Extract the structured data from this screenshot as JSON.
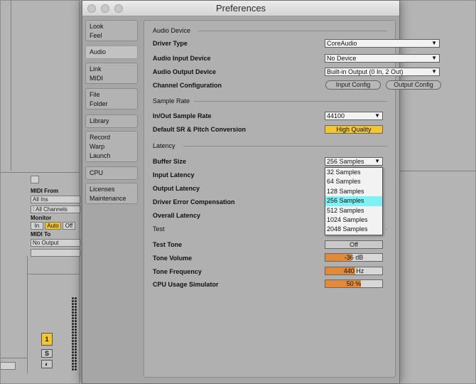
{
  "window": {
    "title": "Preferences"
  },
  "tabs": [
    {
      "lines": [
        "Look",
        "Feel"
      ],
      "active": false
    },
    {
      "lines": [
        "Audio"
      ],
      "active": true
    },
    {
      "lines": [
        "Link",
        "MIDI"
      ],
      "active": false
    },
    {
      "lines": [
        "File",
        "Folder"
      ],
      "active": false
    },
    {
      "lines": [
        "Library"
      ],
      "active": false
    },
    {
      "lines": [
        "Record",
        "Warp",
        "Launch"
      ],
      "active": false
    },
    {
      "lines": [
        "CPU"
      ],
      "active": false
    },
    {
      "lines": [
        "Licenses",
        "Maintenance"
      ],
      "active": false
    }
  ],
  "audio_device": {
    "heading": "Audio Device",
    "driver_type": {
      "label": "Driver Type",
      "value": "CoreAudio"
    },
    "input_device": {
      "label": "Audio Input Device",
      "value": "No Device"
    },
    "output_device": {
      "label": "Audio Output Device",
      "value": "Built-in Output (0 In, 2 Out)"
    },
    "channel_config": {
      "label": "Channel Configuration",
      "input_button": "Input Config",
      "output_button": "Output Config"
    }
  },
  "sample_rate": {
    "heading": "Sample Rate",
    "inout": {
      "label": "In/Out Sample Rate",
      "value": "44100"
    },
    "default_sr": {
      "label": "Default SR & Pitch Conversion",
      "value": "High Quality"
    }
  },
  "latency": {
    "heading": "Latency",
    "buffer_size": {
      "label": "Buffer Size",
      "value": "256 Samples"
    },
    "input_latency": {
      "label": "Input Latency"
    },
    "output_latency": {
      "label": "Output Latency"
    },
    "driver_error": {
      "label": "Driver Error Compensation"
    },
    "overall": {
      "label": "Overall Latency"
    },
    "buffer_options": [
      "32 Samples",
      "64 Samples",
      "128 Samples",
      "256 Samples",
      "512 Samples",
      "1024 Samples",
      "2048 Samples"
    ],
    "selected_index": 3
  },
  "test": {
    "heading": "Test",
    "test_tone": {
      "label": "Test Tone",
      "value": "Off"
    },
    "tone_volume": {
      "label": "Tone Volume",
      "value": "-36 dB",
      "fill": 0.46
    },
    "tone_frequency": {
      "label": "Tone Frequency",
      "value": "440 Hz",
      "fill": 0.52
    },
    "cpu_sim": {
      "label": "CPU Usage Simulator",
      "value": "50 %",
      "fill": 0.62
    }
  },
  "mixer": {
    "midi_from_label": "MIDI From",
    "midi_from_value": "All Ins",
    "channel_value": "All Channels",
    "monitor_label": "Monitor",
    "monitor_options": [
      "In",
      "Auto",
      "Off"
    ],
    "monitor_active": "Auto",
    "midi_to_label": "MIDI To",
    "midi_to_value": "No Output",
    "track_number": "1",
    "solo_label": "S"
  },
  "colors": {
    "accent_yellow": "#f3c531",
    "slider_orange": "#e08a3a",
    "selection_cyan": "#7ff0f4"
  }
}
